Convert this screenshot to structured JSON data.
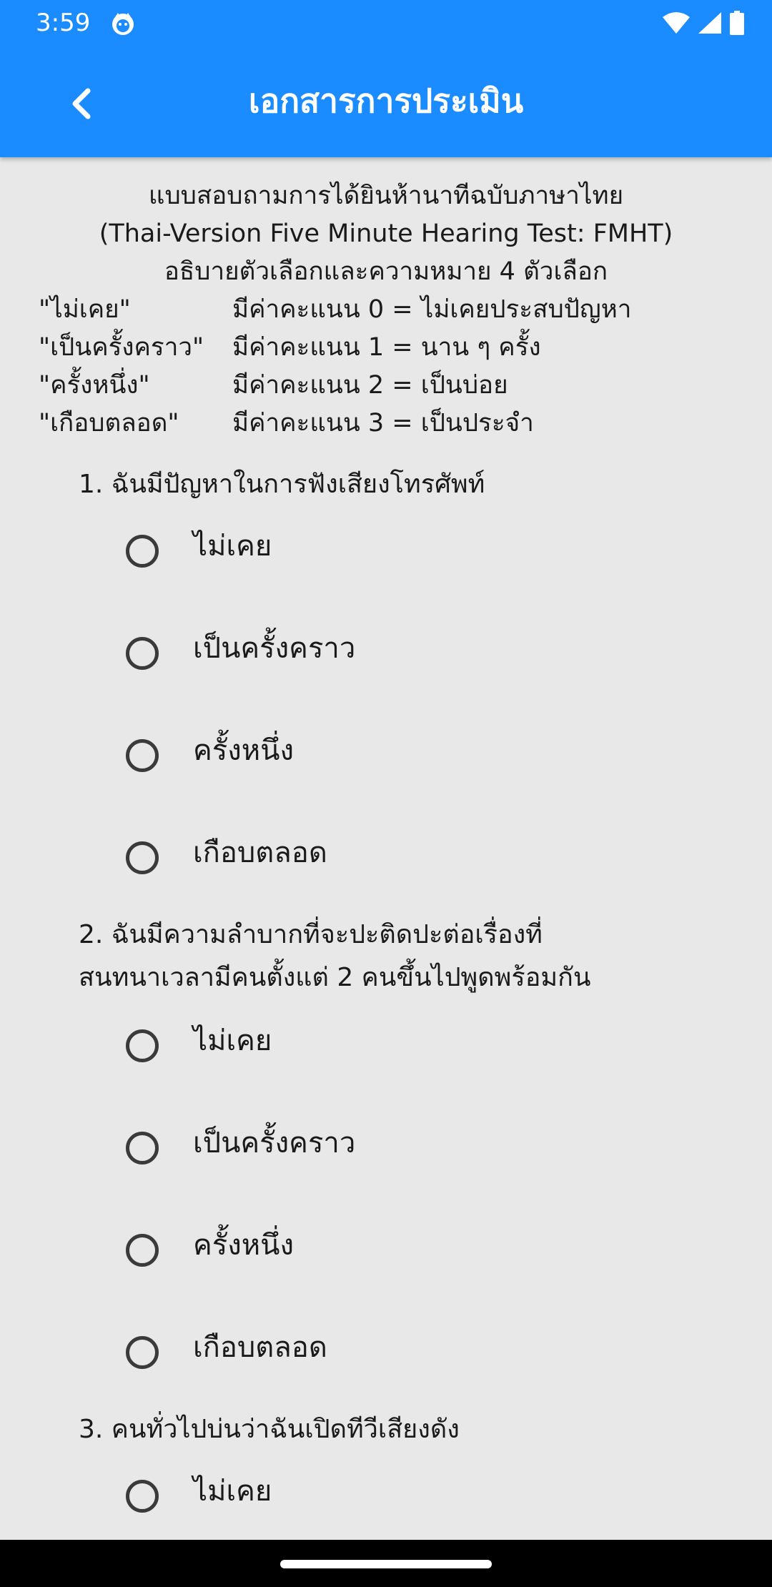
{
  "status_bar": {
    "time": "3:59",
    "icons": [
      "app-notification-icon",
      "wifi-icon",
      "signal-icon",
      "battery-icon"
    ]
  },
  "app_bar": {
    "title": "เอกสารการประเมิน",
    "back_icon": "chevron-left-icon"
  },
  "intro": {
    "line1": "แบบสอบถามการได้ยินห้านาทีฉบับภาษาไทย",
    "line2": "(Thai-Version Five Minute Hearing Test: FMHT)",
    "line3": "อธิบายตัวเลือกและความหมาย 4 ตัวเลือก",
    "legend": [
      {
        "term": "\"ไม่เคย\"",
        "desc": "มีค่าคะแนน 0 = ไม่เคยประสบปัญหา"
      },
      {
        "term": "\"เป็นครั้งคราว\"",
        "desc": "มีค่าคะแนน 1 = นาน ๆ ครั้ง"
      },
      {
        "term": "\"ครั้งหนึ่ง\"",
        "desc": "มีค่าคะแนน 2 = เป็นบ่อย"
      },
      {
        "term": "\"เกือบตลอด\"",
        "desc": "มีค่าคะแนน 3 = เป็นประจำ"
      }
    ]
  },
  "questions": [
    {
      "line1": "1. ฉันมีปัญหาในการฟังเสียงโทรศัพท์",
      "line2": "",
      "options": [
        "ไม่เคย",
        "เป็นครั้งคราว",
        "ครั้งหนึ่ง",
        "เกือบตลอด"
      ]
    },
    {
      "line1": "2. ฉันมีความลำบากที่จะปะติดปะต่อเรื่องที่",
      "line2": "สนทนาเวลามีคนตั้งแต่ 2 คนขึ้นไปพูดพร้อมกัน",
      "options": [
        "ไม่เคย",
        "เป็นครั้งคราว",
        "ครั้งหนึ่ง",
        "เกือบตลอด"
      ]
    },
    {
      "line1": "3. คนทั่วไปบ่นว่าฉันเปิดทีวีเสียงดัง",
      "line2": "",
      "options": [
        "ไม่เคย"
      ]
    }
  ],
  "colors": {
    "app_bar": "#1a8cff",
    "background": "#e8e8e8",
    "radio_stroke": "#3a3a3a",
    "nav_bar": "#000000"
  }
}
